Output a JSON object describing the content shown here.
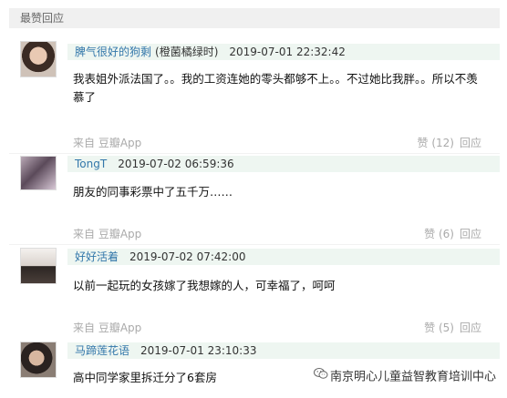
{
  "section": {
    "title": "最赞回应"
  },
  "comments": [
    {
      "author": "脾气很好的狗剩",
      "signature": "(橙菌橘绿时)",
      "time": "2019-07-01 22:32:42",
      "text": "我表姐外派法国了。。我的工资连她的零头都够不上。。不过她比我胖。。所以不羡慕了",
      "source": "来自 豆瓣App",
      "likes": "赞 (12)",
      "reply": "回应"
    },
    {
      "author": "TongT",
      "signature": "",
      "time": "2019-07-02 06:59:36",
      "text": "朋友的同事彩票中了五千万……",
      "source": "来自 豆瓣App",
      "likes": "赞 (6)",
      "reply": "回应"
    },
    {
      "author": "好好活着",
      "signature": "",
      "time": "2019-07-02 07:42:00",
      "text": "以前一起玩的女孩嫁了我想嫁的人，可幸福了，呵呵",
      "source": "来自 豆瓣App",
      "likes": "赞 (5)",
      "reply": "回应"
    },
    {
      "author": "马蹄莲花语",
      "signature": "",
      "time": "2019-07-01 23:10:33",
      "text": "高中同学家里拆迁分了6套房",
      "source": "",
      "likes": "",
      "reply": ""
    }
  ],
  "watermark": {
    "text": "南京明心儿童益智教育培训中心",
    "icon": "wechat-icon"
  }
}
